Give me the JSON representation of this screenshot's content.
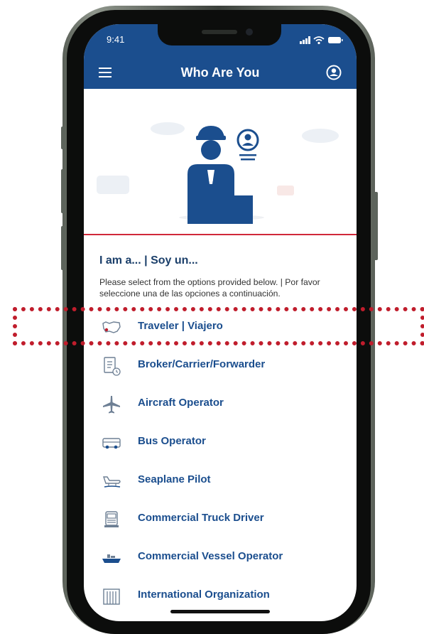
{
  "status_bar": {
    "time": "9:41"
  },
  "header": {
    "title": "Who Are You"
  },
  "content": {
    "heading": "I am a... | Soy un...",
    "description": "Please select from the options provided below. | Por favor seleccione una de las opciones a continuación."
  },
  "options": [
    {
      "label": "Traveler | Viajero",
      "icon": "map-icon"
    },
    {
      "label": "Broker/Carrier/Forwarder",
      "icon": "document-clock-icon"
    },
    {
      "label": "Aircraft Operator",
      "icon": "airplane-icon"
    },
    {
      "label": "Bus Operator",
      "icon": "bus-icon"
    },
    {
      "label": "Seaplane Pilot",
      "icon": "seaplane-icon"
    },
    {
      "label": "Commercial Truck Driver",
      "icon": "truck-icon"
    },
    {
      "label": "Commercial Vessel Operator",
      "icon": "ship-icon"
    },
    {
      "label": "International Organization",
      "icon": "building-icon"
    }
  ],
  "colors": {
    "primary": "#1b4e8e",
    "accent": "#d0283a",
    "highlight": "#c01d2c"
  }
}
